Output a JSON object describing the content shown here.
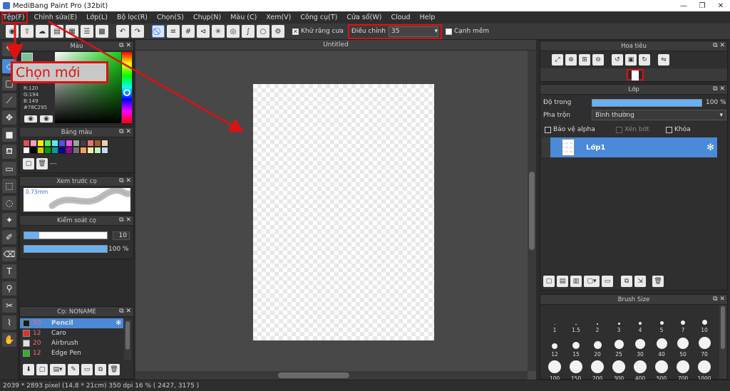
{
  "window": {
    "title": "MediBang Paint Pro (32bit)",
    "min": "—",
    "max": "❐",
    "close": "✕"
  },
  "menu": [
    "Tệp(F)",
    "Chỉnh sửa(E)",
    "Lớp(L)",
    "Bộ lọc(R)",
    "Chọn(S)",
    "Chụp(N)",
    "Màu (C)",
    "Xem(V)",
    "Công cụ(T)",
    "Cửa sổ(W)",
    "Cloud",
    "Help"
  ],
  "toolbar": {
    "antialias_label": "Khử răng cưa",
    "adjust_label": "Điều chỉnh",
    "adjust_value": "35",
    "soft_edge_label": "Cạnh mềm"
  },
  "annotation": {
    "callout": "Chọn mới"
  },
  "color_panel": {
    "title": "Màu",
    "r": "R:120",
    "g": "G:194",
    "b": "B:149",
    "hex": "#78C295"
  },
  "palette_panel": {
    "title": "Bảng màu",
    "more": "---",
    "colors": [
      "#e05050",
      "#f0a0c0",
      "#f0f000",
      "#50f050",
      "#50f0f0",
      "#5050f0",
      "#f050f0",
      "#a0a0a0",
      "#404040",
      "#f07070",
      "#a06030",
      "#f0d0b0",
      "#ffffff",
      "#000000",
      "#d0d000",
      "#00a000",
      "#00a0a0",
      "#0000a0",
      "#a000a0",
      "#707070",
      "#f0a060",
      "#f0f0a0",
      "#c0f0c0",
      "#c0e0f0"
    ]
  },
  "preview_panel": {
    "title": "Xem trước cọ",
    "size": "0.73mm"
  },
  "brush_control_panel": {
    "title": "Kiểm soát cọ",
    "size_value": "10",
    "opacity_value": "100 %",
    "size_fraction": 0.18,
    "opacity_fraction": 1.0
  },
  "brush_panel": {
    "title": "Cọ: NONAME",
    "items": [
      {
        "size": "50",
        "name": "Pencil",
        "color": "#1a1a1a",
        "active": true
      },
      {
        "size": "12",
        "name": "Caro",
        "color": "#e03030",
        "active": false
      },
      {
        "size": "20",
        "name": "Airbrush",
        "color": "#e0e0e0",
        "active": false
      },
      {
        "size": "12",
        "name": "Edge Pen",
        "color": "#30b030",
        "active": false
      }
    ]
  },
  "canvas": {
    "title": "Untitled"
  },
  "navigator_panel": {
    "title": "Hoa tiêu"
  },
  "layer_panel": {
    "title": "Lớp",
    "opacity_label": "Độ trong",
    "opacity_value": "100 %",
    "opacity_fraction": 1.0,
    "blend_label": "Pha trộn",
    "blend_value": "Bình thường",
    "protect_alpha": "Bảo vệ alpha",
    "clip": "Xén bớt",
    "lock": "Khóa",
    "layer_name": "Lớp1"
  },
  "brush_size_panel": {
    "title": "Brush Size",
    "sizes": [
      "1",
      "1.5",
      "2",
      "3",
      "4",
      "5",
      "7",
      "10",
      "12",
      "15",
      "20",
      "25",
      "30",
      "40",
      "50",
      "70",
      "100",
      "150",
      "200",
      "300",
      "400",
      "500",
      "700",
      "1000"
    ]
  },
  "status": {
    "text": "2039 * 2893 pixel   (14.8 * 21cm)   350 dpi   16 %   ( 2427, 3175 )"
  }
}
